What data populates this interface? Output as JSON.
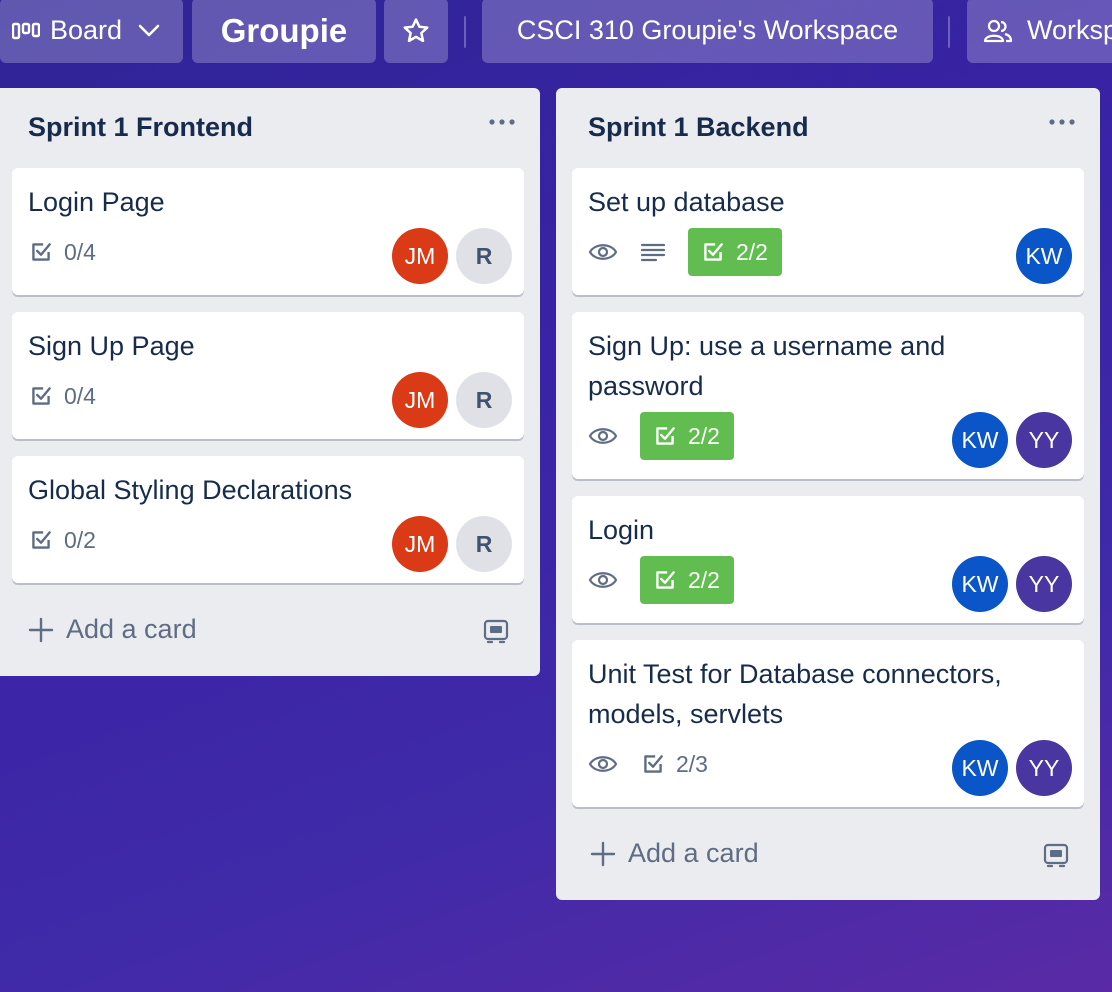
{
  "header": {
    "board_label": "Board",
    "board_title": "Groupie",
    "workspace_label": "CSCI 310 Groupie's Workspace",
    "visibility_label": "Workspace visible"
  },
  "lists": [
    {
      "title": "Sprint 1 Frontend",
      "add_card_label": "Add a card",
      "cards": [
        {
          "title": "Login Page",
          "checklist": "0/4",
          "members": [
            "JM",
            "R"
          ]
        },
        {
          "title": "Sign Up Page",
          "checklist": "0/4",
          "members": [
            "JM",
            "R"
          ]
        },
        {
          "title": "Global Styling Declarations",
          "checklist": "0/2",
          "members": [
            "JM",
            "R"
          ]
        }
      ]
    },
    {
      "title": "Sprint 1 Backend",
      "add_card_label": "Add a card",
      "cards": [
        {
          "title": "Set up database",
          "checklist": "2/2",
          "checklist_complete": true,
          "has_description": true,
          "watching": true,
          "members": [
            "KW"
          ]
        },
        {
          "title": "Sign Up: use a username and password",
          "checklist": "2/2",
          "checklist_complete": true,
          "watching": true,
          "members": [
            "KW",
            "YY"
          ]
        },
        {
          "title": "Login",
          "checklist": "2/2",
          "checklist_complete": true,
          "watching": true,
          "members": [
            "KW",
            "YY"
          ]
        },
        {
          "title": "Unit Test for Database connectors, models, servlets",
          "checklist": "2/3",
          "checklist_complete": false,
          "watching": true,
          "members": [
            "KW",
            "YY"
          ]
        }
      ]
    }
  ],
  "colors": {
    "checklist_complete": "#61bd4f",
    "avatar_jm": "#db3a17",
    "avatar_kw": "#0a56c9",
    "avatar_yy": "#4a36a0",
    "list_bg": "#ebecf0"
  }
}
